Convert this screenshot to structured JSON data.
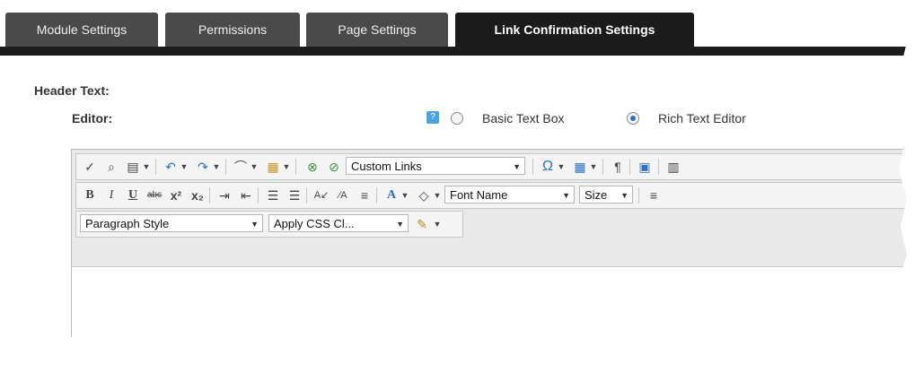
{
  "tabs": [
    {
      "label": "Module Settings"
    },
    {
      "label": "Permissions"
    },
    {
      "label": "Page Settings"
    },
    {
      "label": "Link Confirmation Settings"
    }
  ],
  "section": {
    "label": "Header Text:"
  },
  "editor_row": {
    "label": "Editor:",
    "options": [
      {
        "label": "Basic Text Box",
        "selected": false
      },
      {
        "label": "Rich Text Editor",
        "selected": true
      }
    ]
  },
  "toolbar": {
    "row1": {
      "links_select": "Custom Links"
    },
    "row2": {
      "font_name": "Font Name",
      "size": "Size"
    },
    "row3": {
      "paragraph_style": "Paragraph Style",
      "apply_css": "Apply CSS Cl..."
    }
  },
  "colors": {
    "tab_bg": "#4a4a4a",
    "tab_active": "#1b1b1b",
    "toolbar_bg": "#e9e9e9",
    "accent": "#2e6fc0"
  }
}
